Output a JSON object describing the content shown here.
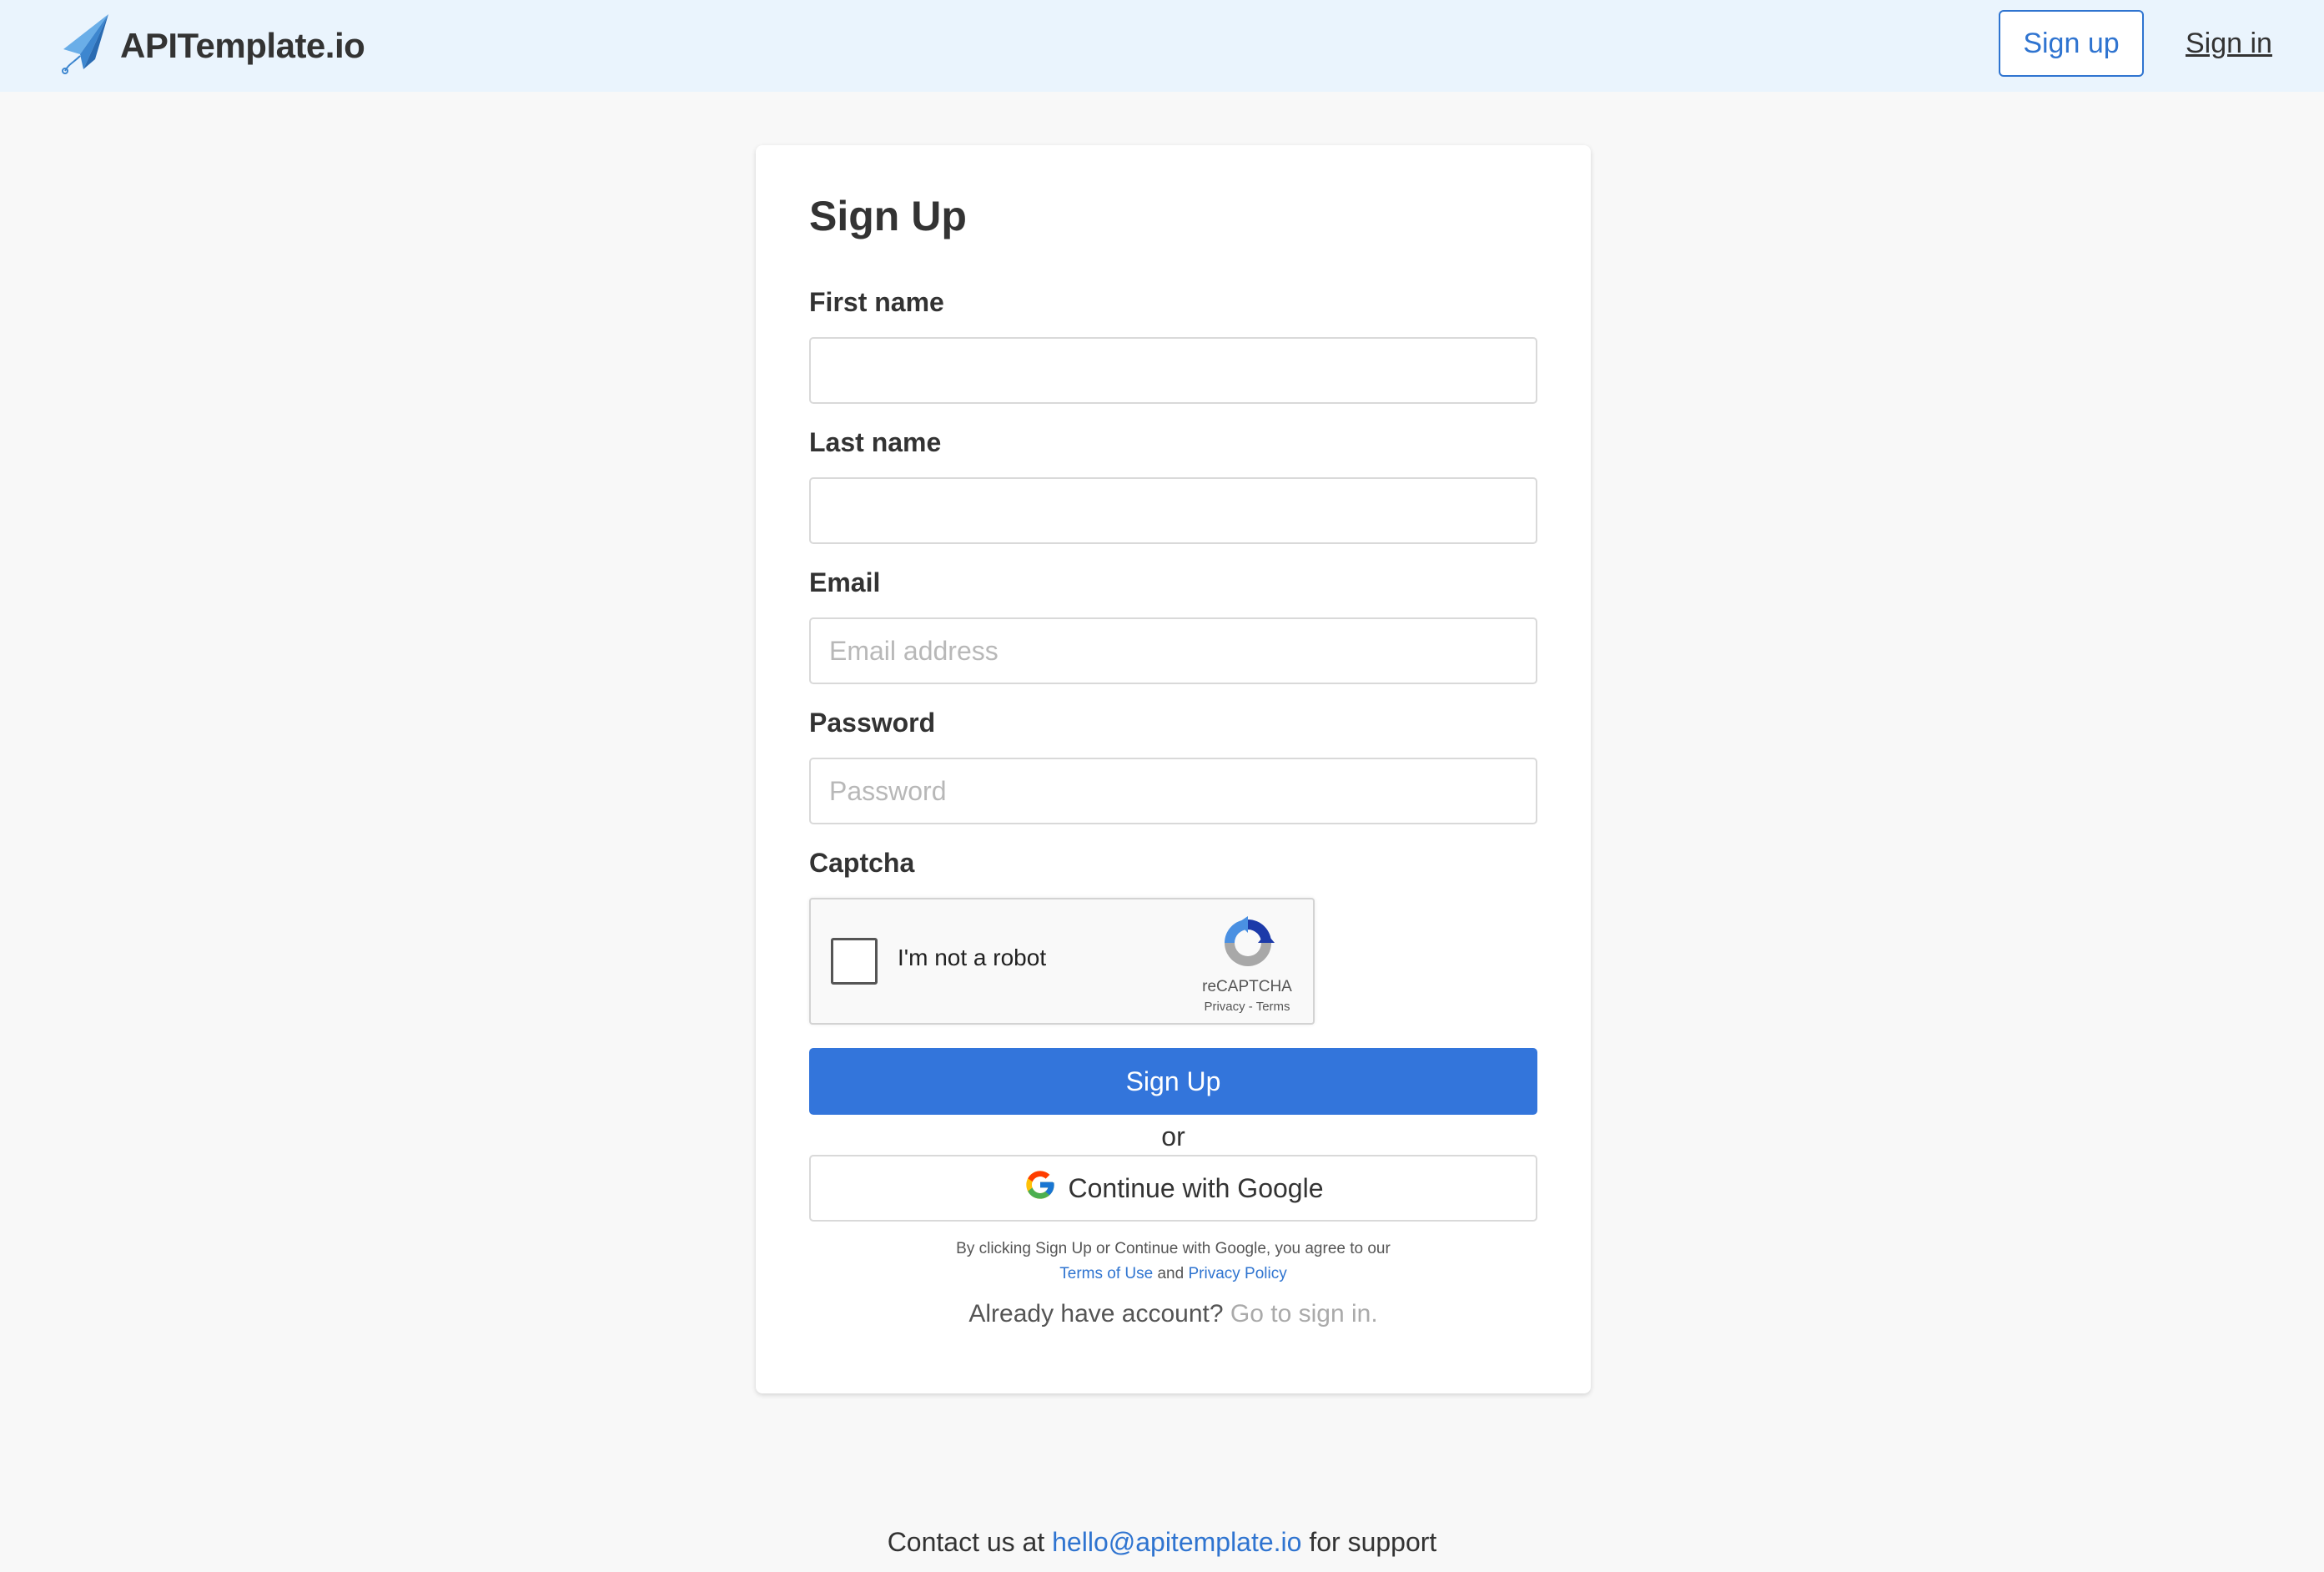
{
  "header": {
    "logo_text": "APITemplate.io",
    "signup_label": "Sign up",
    "signin_label": "Sign in"
  },
  "form": {
    "title": "Sign Up",
    "first_name": {
      "label": "First name",
      "value": "",
      "placeholder": ""
    },
    "last_name": {
      "label": "Last name",
      "value": "",
      "placeholder": ""
    },
    "email": {
      "label": "Email",
      "value": "",
      "placeholder": "Email address"
    },
    "password": {
      "label": "Password",
      "value": "",
      "placeholder": "Password"
    },
    "captcha": {
      "label": "Captcha",
      "checkbox_text": "I'm not a robot",
      "brand": "reCAPTCHA",
      "privacy": "Privacy",
      "separator": " - ",
      "terms": "Terms"
    },
    "submit_label": "Sign Up",
    "or_text": "or",
    "google_label": "Continue with Google",
    "legal_prefix": "By clicking Sign Up or Continue with Google, you agree to our",
    "terms_of_use": "Terms of Use",
    "and_text": " and ",
    "privacy_policy": "Privacy Policy",
    "already_text": "Already have account? ",
    "go_signin": "Go to sign in."
  },
  "footer": {
    "prefix": "Contact us at ",
    "email": "hello@apitemplate.io",
    "suffix": " for support"
  },
  "colors": {
    "accent": "#3375db",
    "link": "#2f74d0",
    "header_bg": "#eaf4fd",
    "page_bg": "#f8f8f8"
  },
  "icons": {
    "logo": "paper-plane-icon",
    "recaptcha": "recaptcha-icon",
    "google": "google-g-icon"
  }
}
